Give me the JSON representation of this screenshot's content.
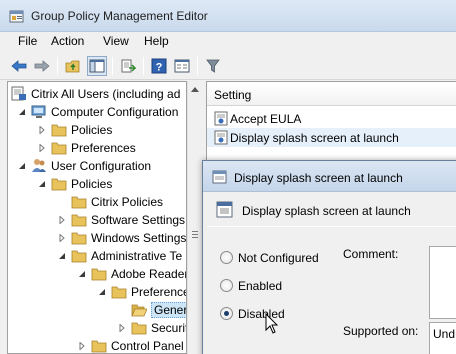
{
  "window": {
    "title": "Group Policy Management Editor",
    "icon": "gpo-editor-icon"
  },
  "menu": [
    "File",
    "Action",
    "View",
    "Help"
  ],
  "toolbar": {
    "buttons": [
      "back-arrow-icon",
      "forward-arrow-icon",
      "up-folder-icon",
      "show-hide-tree-icon",
      "export-list-icon",
      "help-icon",
      "properties-icon",
      "filter-icon"
    ]
  },
  "tree": {
    "items": [
      {
        "label": "Citrix All Users (including ad",
        "icon": "gpo-icon"
      },
      {
        "label": "Computer Configuration",
        "icon": "computer-icon"
      },
      {
        "label": "Policies",
        "icon": "folder-icon"
      },
      {
        "label": "Preferences",
        "icon": "folder-icon"
      },
      {
        "label": "User Configuration",
        "icon": "users-icon"
      },
      {
        "label": "Policies",
        "icon": "folder-icon"
      },
      {
        "label": "Citrix Policies",
        "icon": "folder-icon"
      },
      {
        "label": "Software Settings",
        "icon": "folder-icon"
      },
      {
        "label": "Windows Settings",
        "icon": "folder-icon"
      },
      {
        "label": "Administrative Te",
        "icon": "folder-icon"
      },
      {
        "label": "Adobe Reader",
        "icon": "folder-icon"
      },
      {
        "label": "Preference",
        "icon": "folder-icon"
      },
      {
        "label": "Genera",
        "icon": "folder-open-icon"
      },
      {
        "label": "Securit",
        "icon": "folder-icon"
      },
      {
        "label": "Control Panel",
        "icon": "folder-icon"
      }
    ]
  },
  "list": {
    "column_header": "Setting",
    "rows": [
      {
        "label": "Accept EULA",
        "icon": "setting-icon"
      },
      {
        "label": "Display splash screen at launch",
        "icon": "setting-icon"
      }
    ]
  },
  "dialog": {
    "title": "Display splash screen at launch",
    "heading": "Display splash screen at launch",
    "options": [
      {
        "label": "Not Configured",
        "selected": false
      },
      {
        "label": "Enabled",
        "selected": false
      },
      {
        "label": "Disabled",
        "selected": true
      }
    ],
    "comment_label": "Comment:",
    "supported_label": "Supported on:",
    "supported_value": "Und"
  },
  "colors": {
    "selection": "#cde6f7",
    "folder": "#e8c25a",
    "radio_dot": "#1c3c6c"
  }
}
